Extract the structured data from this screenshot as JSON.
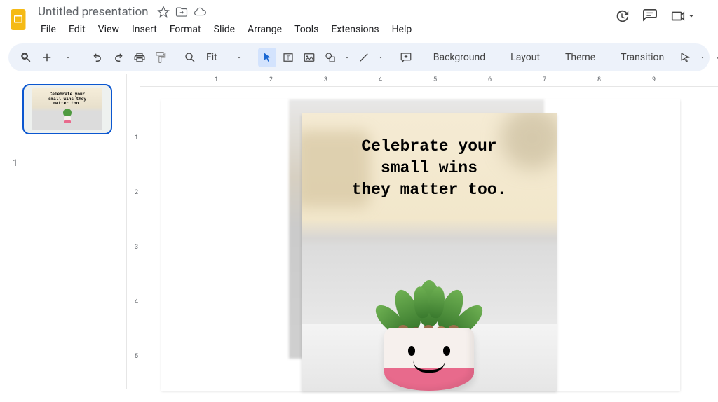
{
  "doc": {
    "title": "Untitled presentation"
  },
  "menu": [
    "File",
    "Edit",
    "View",
    "Insert",
    "Format",
    "Slide",
    "Arrange",
    "Tools",
    "Extensions",
    "Help"
  ],
  "toolbar": {
    "zoom_label": "Fit",
    "background": "Background",
    "layout": "Layout",
    "theme": "Theme",
    "transition": "Transition"
  },
  "slide_number": "1",
  "slide_image_text": "Celebrate your\nsmall wins\nthey matter too.",
  "thumb_text": "Celebrate your\nsmall wins\nthey matter too.",
  "ruler_h": [
    "",
    "1",
    "2",
    "3",
    "4",
    "5",
    "6",
    "7",
    "8",
    "9"
  ],
  "ruler_v": [
    "",
    "1",
    "2",
    "3",
    "4",
    "5"
  ]
}
